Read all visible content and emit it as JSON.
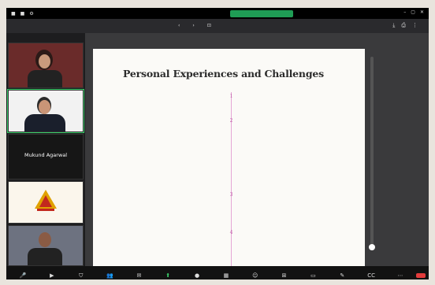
{
  "top_bar": {
    "share_status": "",
    "right_items": []
  },
  "presentation": {
    "doc_title": "",
    "page_info": "",
    "zoom": ""
  },
  "participants": [
    {
      "name": ""
    },
    {
      "name": ""
    },
    {
      "name": "Mukund Agarwal"
    },
    {
      "name": ""
    },
    {
      "name": ""
    }
  ],
  "slide": {
    "title": "Personal Experiences and Challenges",
    "right_entries": [
      {
        "number": "1",
        "heading": "",
        "body": ""
      },
      {
        "number": "3",
        "heading": "",
        "body": ""
      }
    ],
    "left_entries": [
      {
        "number": "2",
        "heading": "",
        "body": ""
      },
      {
        "number": "4",
        "heading": "",
        "body": ""
      }
    ]
  },
  "bottom_toolbar": {
    "items": [
      "",
      "",
      "",
      "",
      "",
      "",
      "",
      "",
      "",
      "",
      "",
      "",
      "",
      "",
      ""
    ],
    "end_label": ""
  },
  "colors": {
    "accent_green": "#3bd26b",
    "timeline_pink": "#e4a6d6",
    "end_red": "#e23b3b"
  }
}
